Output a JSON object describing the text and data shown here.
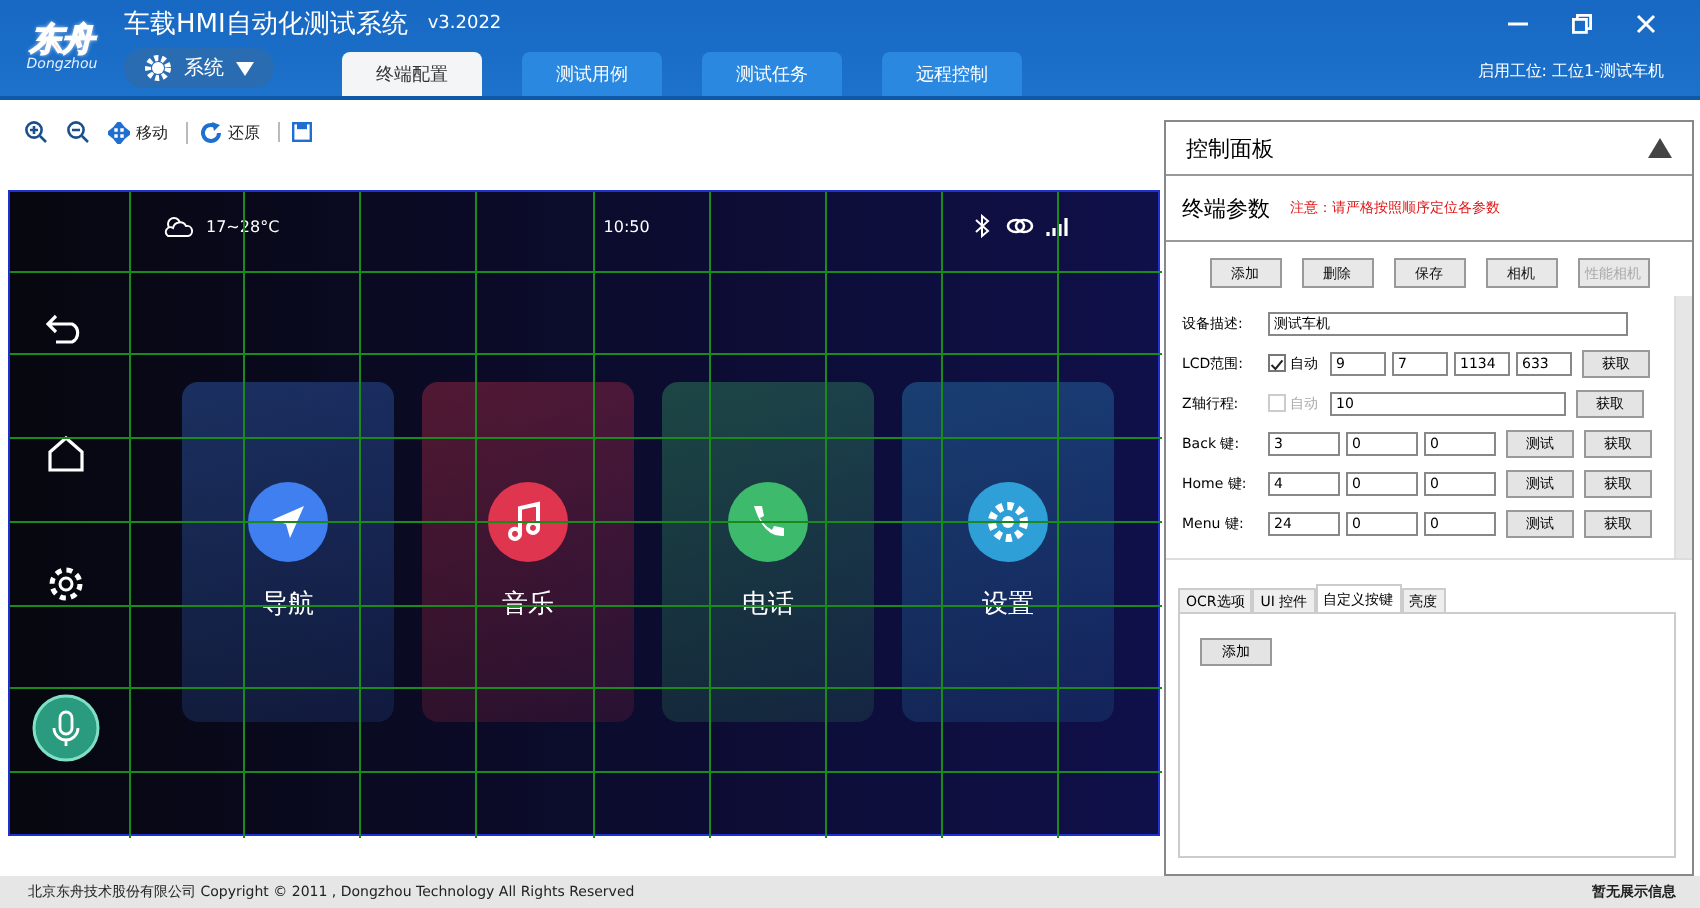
{
  "app": {
    "logo": "东舟",
    "logo_sub": "Dongzhou",
    "title": "车载HMI自动化测试系统",
    "version": "v3.2022",
    "system_menu": "系统",
    "workstation": "启用工位: 工位1-测试车机"
  },
  "tabs": [
    {
      "label": "终端配置",
      "selected": true
    },
    {
      "label": "测试用例",
      "selected": false
    },
    {
      "label": "测试任务",
      "selected": false
    },
    {
      "label": "远程控制",
      "selected": false
    }
  ],
  "toolbar": [
    {
      "kind": "zoom-in"
    },
    {
      "kind": "zoom-out"
    },
    {
      "kind": "move",
      "label": "移动"
    },
    {
      "kind": "reset",
      "label": "还原"
    },
    {
      "kind": "save"
    }
  ],
  "screen": {
    "weather": "17~28°C",
    "time": "10:50",
    "apps": [
      {
        "label": "导航",
        "color": "#3f7ff0",
        "kind": "nav"
      },
      {
        "label": "音乐",
        "color": "#e0354f",
        "kind": "music"
      },
      {
        "label": "电话",
        "color": "#3dba6c",
        "kind": "phone"
      },
      {
        "label": "设置",
        "color": "#2f9fd8",
        "kind": "settings"
      }
    ]
  },
  "panel": {
    "title": "控制面板",
    "section": "终端参数",
    "warning": "注意：请严格按照顺序定位各参数",
    "buttons": [
      {
        "label": "添加",
        "disabled": false
      },
      {
        "label": "删除",
        "disabled": false
      },
      {
        "label": "保存",
        "disabled": false
      },
      {
        "label": "相机",
        "disabled": false
      },
      {
        "label": "性能相机",
        "disabled": true
      }
    ],
    "rows": [
      {
        "kind": "text",
        "label": "设备描述:",
        "value": "测试车机"
      },
      {
        "kind": "range",
        "label": "LCD范围:",
        "auto": {
          "label": "自动",
          "checked": true
        },
        "values": [
          "9",
          "7",
          "1134",
          "633"
        ],
        "action": "获取"
      },
      {
        "kind": "single",
        "label": "Z轴行程:",
        "auto": {
          "label": "自动",
          "checked": false
        },
        "value": "10",
        "action": "获取"
      },
      {
        "kind": "key",
        "label": "Back 键:",
        "values": [
          "3",
          "0",
          "0"
        ],
        "test": "测试",
        "action": "获取"
      },
      {
        "kind": "key",
        "label": "Home 键:",
        "values": [
          "4",
          "0",
          "0"
        ],
        "test": "测试",
        "action": "获取"
      },
      {
        "kind": "key",
        "label": "Menu 键:",
        "values": [
          "24",
          "0",
          "0"
        ],
        "test": "测试",
        "action": "获取"
      }
    ],
    "subtabs": [
      {
        "label": "OCR选项",
        "selected": false
      },
      {
        "label": "UI 控件",
        "selected": false
      },
      {
        "label": "自定义按键",
        "selected": true
      },
      {
        "label": "亮度",
        "selected": false
      }
    ],
    "add_button": "添加"
  },
  "footer": {
    "copyright": "北京东舟技术股份有限公司  Copyright © 2011 , Dongzhou Technology All Rights Reserved",
    "status": "暂无展示信息"
  }
}
